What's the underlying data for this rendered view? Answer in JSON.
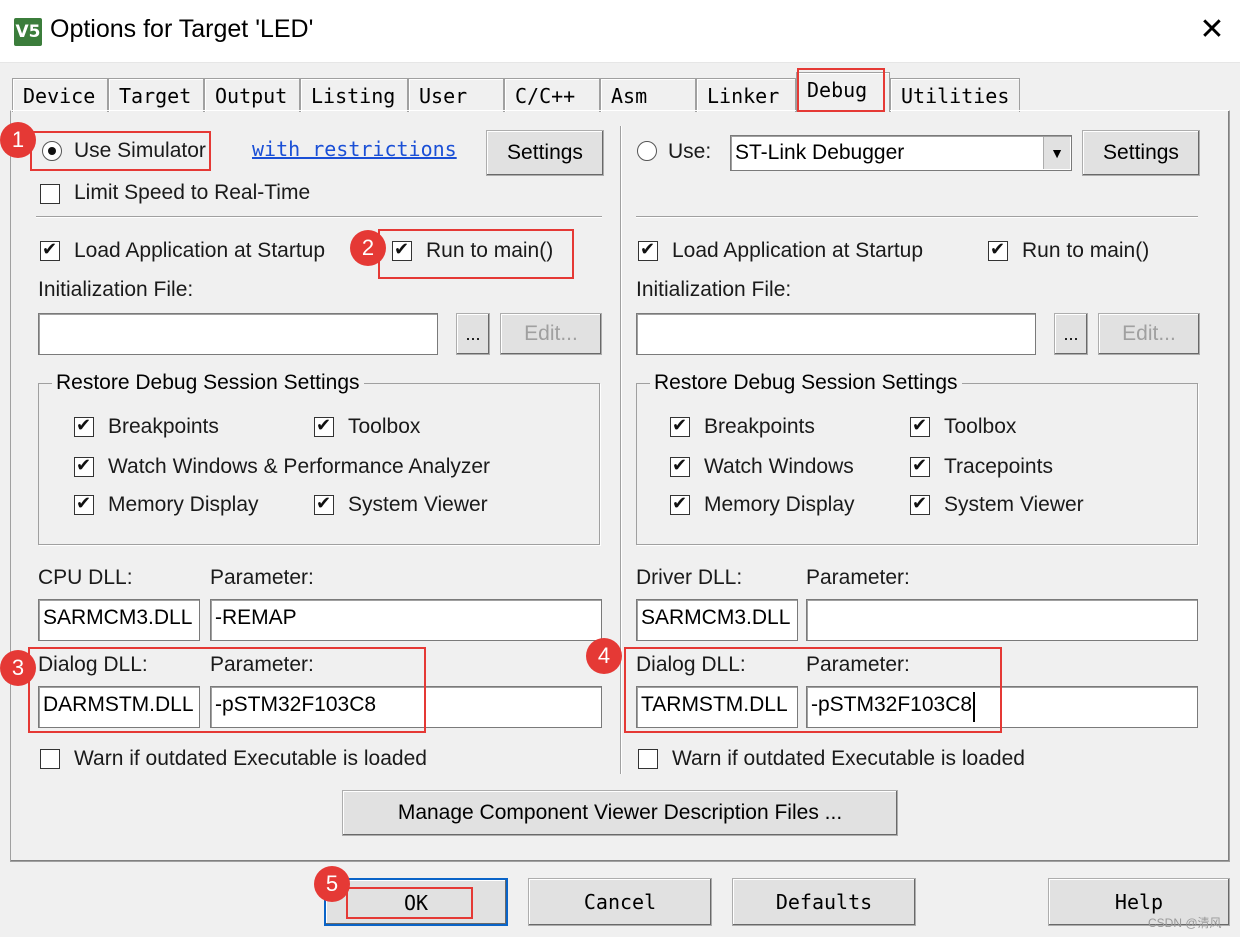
{
  "window": {
    "app_icon_text": "V5",
    "title": "Options for Target 'LED'",
    "close": "✕"
  },
  "tabs": [
    {
      "label": "Device"
    },
    {
      "label": "Target"
    },
    {
      "label": "Output"
    },
    {
      "label": "Listing"
    },
    {
      "label": "User"
    },
    {
      "label": "C/C++"
    },
    {
      "label": "Asm"
    },
    {
      "label": "Linker"
    },
    {
      "label": "Debug",
      "active": true
    },
    {
      "label": "Utilities"
    }
  ],
  "left": {
    "use_simulator": "Use Simulator",
    "with_restrictions": "with restrictions",
    "settings": "Settings",
    "limit_speed": "Limit Speed to Real-Time",
    "load_app": "Load Application at Startup",
    "run_to_main": "Run to main()",
    "init_file_label": "Initialization File:",
    "init_file_value": "",
    "browse": "...",
    "edit": "Edit...",
    "restore_group": "Restore Debug Session Settings",
    "breakpoints": "Breakpoints",
    "toolbox": "Toolbox",
    "watch_windows": "Watch Windows & Performance Analyzer",
    "memory_display": "Memory Display",
    "system_viewer": "System Viewer",
    "cpu_dll_label": "CPU DLL:",
    "parameter_label": "Parameter:",
    "cpu_dll_value": "SARMCM3.DLL",
    "cpu_param_value": "-REMAP",
    "dialog_dll_label": "Dialog DLL:",
    "dialog_dll_value": "DARMSTM.DLL",
    "dialog_param_value": "-pSTM32F103C8",
    "warn_outdated": "Warn if outdated Executable is loaded"
  },
  "right": {
    "use": "Use:",
    "debugger": "ST-Link Debugger",
    "settings": "Settings",
    "load_app": "Load Application at Startup",
    "run_to_main": "Run to main()",
    "init_file_label": "Initialization File:",
    "init_file_value": "",
    "browse": "...",
    "edit": "Edit...",
    "restore_group": "Restore Debug Session Settings",
    "breakpoints": "Breakpoints",
    "toolbox": "Toolbox",
    "watch_windows": "Watch Windows",
    "tracepoints": "Tracepoints",
    "memory_display": "Memory Display",
    "system_viewer": "System Viewer",
    "driver_dll_label": "Driver DLL:",
    "parameter_label": "Parameter:",
    "driver_dll_value": "SARMCM3.DLL",
    "driver_param_value": "",
    "dialog_dll_label": "Dialog DLL:",
    "dialog_dll_value": "TARMSTM.DLL",
    "dialog_param_value": "-pSTM32F103C8",
    "warn_outdated": "Warn if outdated Executable is loaded"
  },
  "manage_button": "Manage Component Viewer Description Files ...",
  "footer": {
    "ok": "OK",
    "cancel": "Cancel",
    "defaults": "Defaults",
    "help": "Help"
  },
  "badges": [
    "1",
    "2",
    "3",
    "4",
    "5"
  ],
  "watermark": "CSDN @清风",
  "colors": {
    "annotation_red": "#e53935",
    "link_blue": "#1a4fd6"
  }
}
